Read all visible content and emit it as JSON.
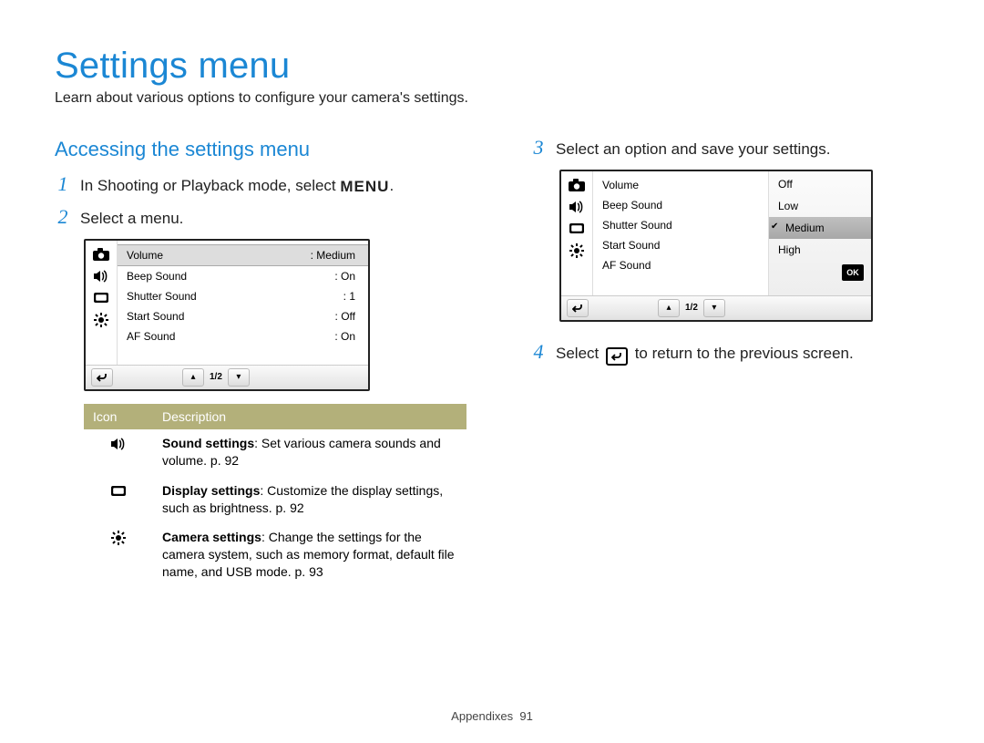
{
  "title": "Settings menu",
  "intro": "Learn about various options to configure your camera's settings.",
  "subhead": "Accessing the settings menu",
  "steps": {
    "s1_a": "In Shooting or Playback mode, select ",
    "s1_menu": "MENU",
    "s1_b": ".",
    "s2": "Select a menu.",
    "s3": "Select an option and save your settings.",
    "s4_a": "Select ",
    "s4_b": " to return to the previous screen."
  },
  "screen1": {
    "rows": [
      {
        "label": "Volume",
        "value": ": Medium"
      },
      {
        "label": "Beep Sound",
        "value": ": On"
      },
      {
        "label": "Shutter Sound",
        "value": ": 1"
      },
      {
        "label": "Start Sound",
        "value": ": Off"
      },
      {
        "label": "AF Sound",
        "value": ": On"
      }
    ],
    "page": "1/2"
  },
  "screen2": {
    "rows": [
      {
        "label": "Volume"
      },
      {
        "label": "Beep Sound"
      },
      {
        "label": "Shutter Sound"
      },
      {
        "label": "Start Sound"
      },
      {
        "label": "AF Sound"
      }
    ],
    "options": [
      "Off",
      "Low",
      "Medium",
      "High"
    ],
    "selectedIndex": 2,
    "ok": "OK",
    "page": "1/2"
  },
  "table": {
    "head": {
      "c1": "Icon",
      "c2": "Description"
    },
    "rows": [
      {
        "bold": "Sound settings",
        "rest": ": Set various camera sounds and volume. p. 92"
      },
      {
        "bold": "Display settings",
        "rest": ": Customize the display settings, such as brightness. p. 92"
      },
      {
        "bold": "Camera settings",
        "rest": ": Change the settings for the camera system, such as memory format, default file name, and USB mode. p. 93"
      }
    ]
  },
  "footer": {
    "section": "Appendixes",
    "page": "91"
  }
}
